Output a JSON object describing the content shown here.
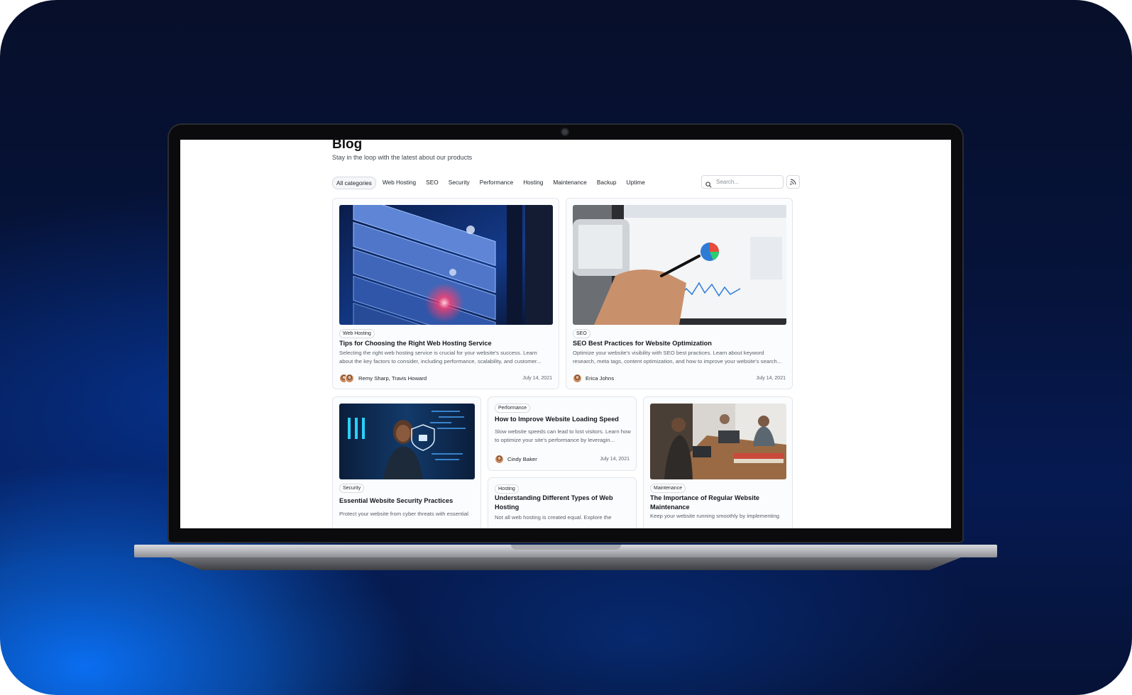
{
  "blog": {
    "title": "Blog",
    "subtitle": "Stay in the loop with the latest about our products"
  },
  "categories": [
    {
      "label": "All categories",
      "active": true
    },
    {
      "label": "Web Hosting",
      "active": false
    },
    {
      "label": "SEO",
      "active": false
    },
    {
      "label": "Security",
      "active": false
    },
    {
      "label": "Performance",
      "active": false
    },
    {
      "label": "Hosting",
      "active": false
    },
    {
      "label": "Maintenance",
      "active": false
    },
    {
      "label": "Backup",
      "active": false
    },
    {
      "label": "Uptime",
      "active": false
    }
  ],
  "search": {
    "placeholder": "Search..."
  },
  "icons": {
    "search": "search-icon",
    "rss": "rss-feed-icon"
  },
  "posts": [
    {
      "tag": "Web Hosting",
      "title": "Tips for Choosing the Right Web Hosting Service",
      "description": "Selecting the right web hosting service is crucial for your website's success. Learn about the key factors to consider, including performance, scalability, and customer...",
      "author": "Remy Sharp, Travis Howard",
      "date": "July 14, 2021"
    },
    {
      "tag": "SEO",
      "title": "SEO Best Practices for Website Optimization",
      "description": "Optimize your website's visibility with SEO best practices. Learn about keyword research, meta tags, content optimization, and how to improve your website's search...",
      "author": "Erica Johns",
      "date": "July 14, 2021"
    },
    {
      "tag": "Security",
      "title": "Essential Website Security Practices",
      "description": "Protect your website from cyber threats with essential"
    },
    {
      "tag": "Performance",
      "title": "How to Improve Website Loading Speed",
      "description": "Slow website speeds can lead to lost visitors. Learn how to optimize your site's performance by leveragin...",
      "author": "Cindy Baker",
      "date": "July 14, 2021"
    },
    {
      "tag": "Hosting",
      "title": "Understanding Different Types of Web Hosting",
      "description": "Not all web hosting is created equal. Explore the"
    },
    {
      "tag": "Maintenance",
      "title": "The Importance of Regular Website Maintenance",
      "description": "Keep your website running smoothly by implementing"
    }
  ],
  "colors": {
    "background_dark": "#070f2a",
    "background_glow": "#0a6ef0",
    "laptop_bezel": "#0b0b0d",
    "card_border": "#e3e6ea"
  }
}
